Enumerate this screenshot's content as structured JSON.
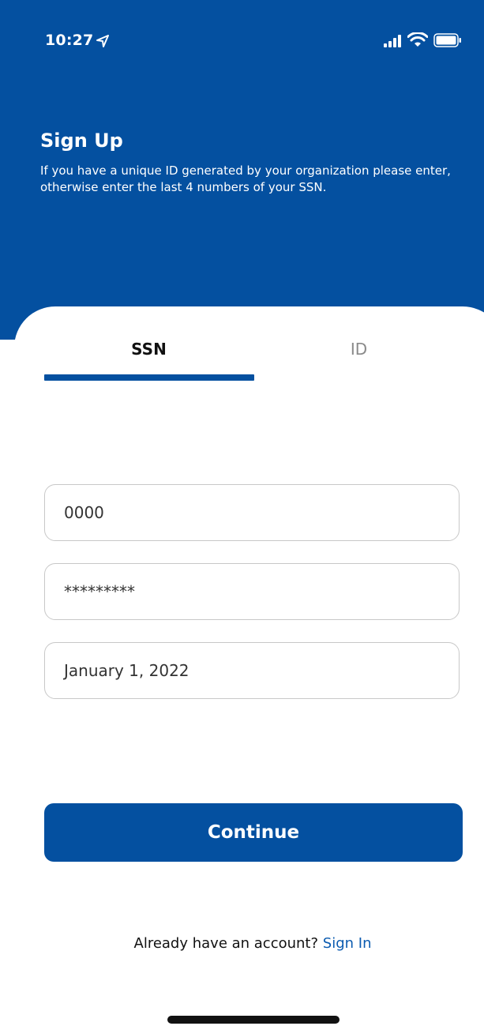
{
  "status_bar": {
    "time": "10:27",
    "icons": [
      "location-arrow-icon",
      "signal-icon",
      "wifi-icon",
      "battery-icon"
    ]
  },
  "header": {
    "title": "Sign Up",
    "subtitle": "If you have a unique ID generated by your organization please enter, otherwise enter the last 4 numbers of your SSN.",
    "background_color": "#0450a0"
  },
  "tabs": [
    {
      "label": "SSN",
      "selected": true
    },
    {
      "label": "ID",
      "selected": false
    }
  ],
  "form": {
    "ssn_value": "0000",
    "password_value": "*********",
    "dob_value": "January 1, 2022"
  },
  "actions": {
    "continue_label": "Continue"
  },
  "footer": {
    "prompt": "Already have an account?",
    "link_label": "Sign In"
  },
  "colors": {
    "primary": "#0450a0",
    "link": "#0b5bb0"
  }
}
